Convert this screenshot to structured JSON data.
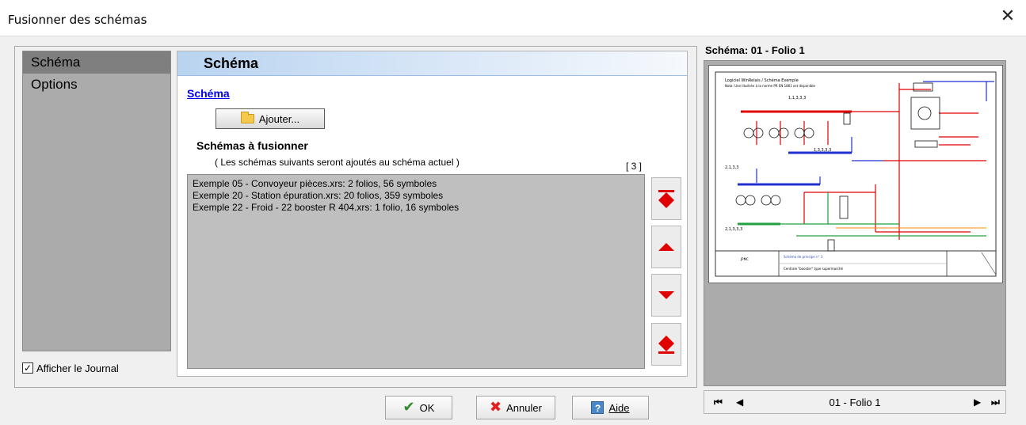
{
  "window": {
    "title": "Fusionner des schémas",
    "close_glyph": "✕"
  },
  "nav": {
    "items": [
      {
        "label": "Schéma",
        "selected": true
      },
      {
        "label": "Options",
        "selected": false
      }
    ]
  },
  "journal": {
    "label": "Afficher le Journal",
    "checked": true
  },
  "panel": {
    "header": "Schéma",
    "section_link": "Schéma",
    "add_button": "Ajouter...",
    "merge_title": "Schémas à fusionner",
    "merge_subtitle": "( Les schémas suivants seront ajoutés au schéma actuel )",
    "count": "[ 3 ]",
    "items": [
      "Exemple 05 - Convoyeur pièces.xrs: 2 folios, 56 symboles",
      "Exemple 20 - Station épuration.xrs: 20 folios, 359 symboles",
      "Exemple 22 - Froid - 22 booster R 404.xrs: 1 folio, 16 symboles"
    ]
  },
  "buttons": {
    "ok": "OK",
    "cancel": "Annuler",
    "help": "Aide"
  },
  "preview": {
    "title": "Schéma: 01 - Folio 1",
    "page_label": "01 - Folio 1",
    "sheet_header_line1": "Logiciel WinRelais / Schéma Exemple",
    "sheet_header_line2": "Nota: Une Illustrée à la norme PR EN 1861 est disponible",
    "sheet_footer_left": "JPMC",
    "sheet_footer_mid1": "Schéma de principe n° 3",
    "sheet_footer_mid2": "Centrale \"booster\" type supermarché"
  },
  "colors": {
    "accent_red": "#e00000",
    "list_bg": "#bfbfbf",
    "nav_bg": "#ababab"
  }
}
